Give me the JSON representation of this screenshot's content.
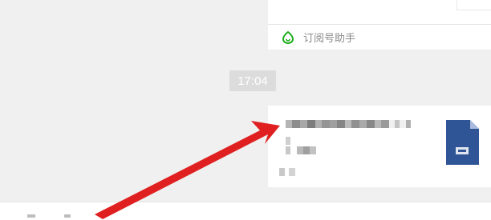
{
  "chat": {
    "source_label": "订阅号助手",
    "timestamp": "17:04"
  },
  "icons": {
    "source": "subscription-assistant-icon",
    "document": "word-document-icon",
    "annotation": "red-arrow"
  },
  "colors": {
    "background": "#f0f0f0",
    "card": "#ffffff",
    "accent_green": "#1aad19",
    "document_blue": "#2f5597",
    "annotation_red": "#e02020"
  }
}
